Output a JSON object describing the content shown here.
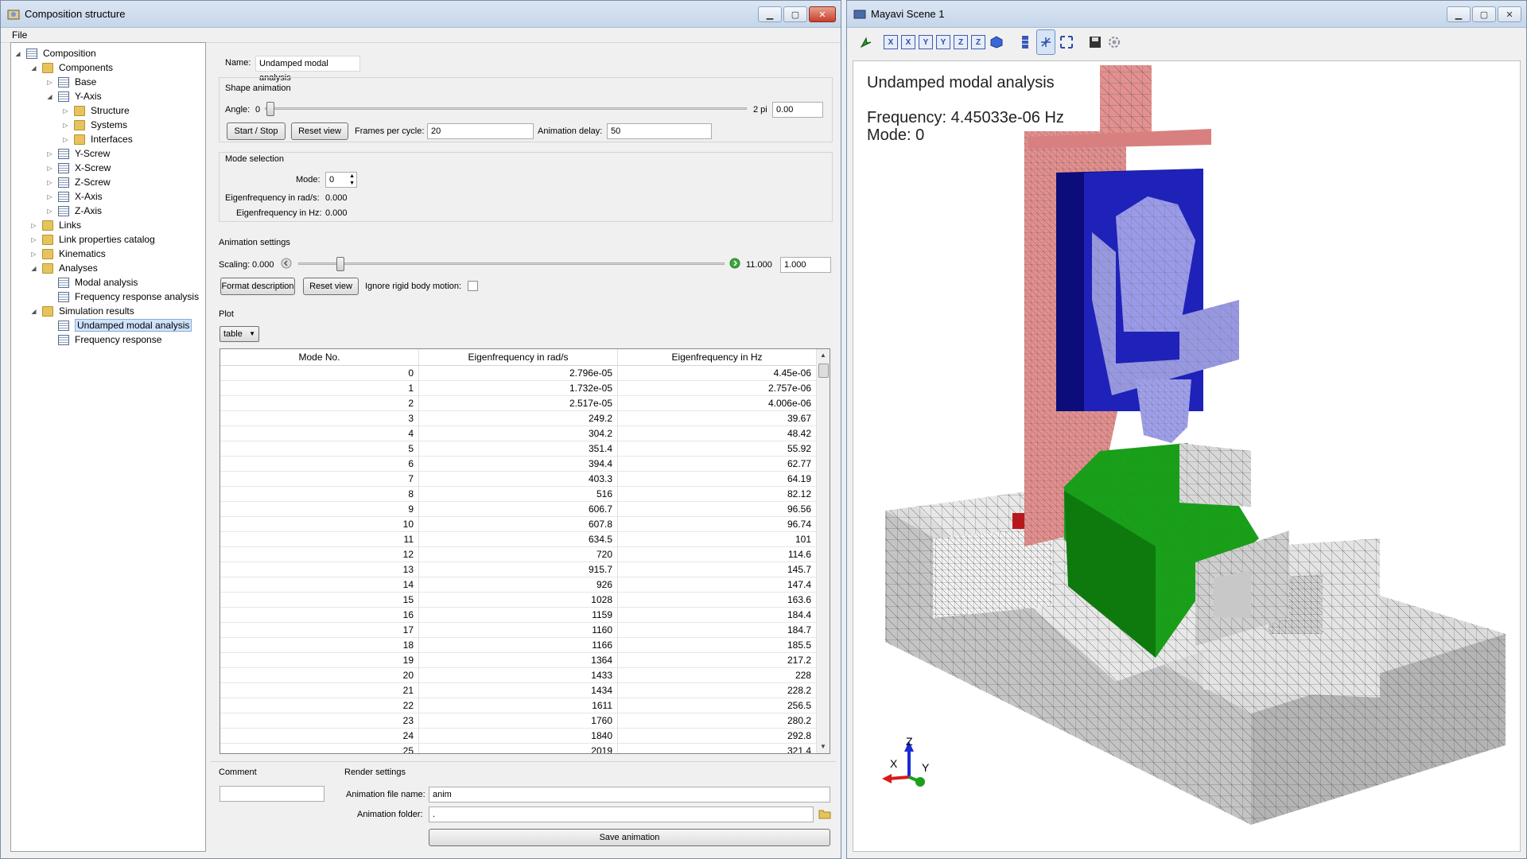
{
  "left_window": {
    "title": "Composition structure",
    "menu": {
      "file": "File"
    },
    "tree": [
      {
        "label": "Composition",
        "icon": "doc-icon",
        "depth": 0,
        "expander": "open"
      },
      {
        "label": "Components",
        "icon": "folder-icon",
        "depth": 1,
        "expander": "open"
      },
      {
        "label": "Base",
        "icon": "doc-icon",
        "depth": 2,
        "expander": "closed"
      },
      {
        "label": "Y-Axis",
        "icon": "doc-icon",
        "depth": 2,
        "expander": "open"
      },
      {
        "label": "Structure",
        "icon": "folder-icon",
        "depth": 3,
        "expander": "closed"
      },
      {
        "label": "Systems",
        "icon": "folder-icon",
        "depth": 3,
        "expander": "closed"
      },
      {
        "label": "Interfaces",
        "icon": "folder-icon",
        "depth": 3,
        "expander": "closed"
      },
      {
        "label": "Y-Screw",
        "icon": "doc-icon",
        "depth": 2,
        "expander": "closed"
      },
      {
        "label": "X-Screw",
        "icon": "doc-icon",
        "depth": 2,
        "expander": "closed"
      },
      {
        "label": "Z-Screw",
        "icon": "doc-icon",
        "depth": 2,
        "expander": "closed"
      },
      {
        "label": "X-Axis",
        "icon": "doc-icon",
        "depth": 2,
        "expander": "closed"
      },
      {
        "label": "Z-Axis",
        "icon": "doc-icon",
        "depth": 2,
        "expander": "closed"
      },
      {
        "label": "Links",
        "icon": "folder-icon",
        "depth": 1,
        "expander": "closed"
      },
      {
        "label": "Link properties catalog",
        "icon": "folder-icon",
        "depth": 1,
        "expander": "closed"
      },
      {
        "label": "Kinematics",
        "icon": "folder-icon",
        "depth": 1,
        "expander": "closed"
      },
      {
        "label": "Analyses",
        "icon": "folder-icon",
        "depth": 1,
        "expander": "open"
      },
      {
        "label": "Modal analysis",
        "icon": "doc-icon",
        "depth": 2,
        "expander": "none"
      },
      {
        "label": "Frequency response analysis",
        "icon": "doc-icon",
        "depth": 2,
        "expander": "none"
      },
      {
        "label": "Simulation results",
        "icon": "folder-icon",
        "depth": 1,
        "expander": "open"
      },
      {
        "label": "Undamped modal analysis",
        "icon": "doc-icon",
        "depth": 2,
        "expander": "none",
        "selected": true
      },
      {
        "label": "Frequency response",
        "icon": "doc-icon",
        "depth": 2,
        "expander": "none"
      }
    ],
    "name_label": "Name:",
    "name_value": "Undamped modal analysis",
    "shape_animation": {
      "title": "Shape animation",
      "angle_label": "Angle:",
      "angle_min": "0",
      "angle_max": "2 pi",
      "angle_value": "0.00",
      "start_stop": "Start / Stop",
      "reset_view": "Reset view",
      "frames_label": "Frames per cycle:",
      "frames_value": "20",
      "delay_label": "Animation delay:",
      "delay_value": "50"
    },
    "mode_selection": {
      "title": "Mode selection",
      "mode_label": "Mode:",
      "mode_value": "0",
      "rad_label": "Eigenfrequency in rad/s:",
      "rad_value": "0.000",
      "hz_label": "Eigenfrequency in Hz:",
      "hz_value": "0.000"
    },
    "animation_settings": {
      "title": "Animation settings",
      "scaling_label": "Scaling:",
      "scaling_min": "0.000",
      "scaling_max": "11.000",
      "scaling_value": "1.000",
      "format_description": "Format description",
      "reset_view": "Reset view",
      "ignore_label": "Ignore rigid body motion:"
    },
    "plot": {
      "title": "Plot",
      "select_value": "table",
      "columns": [
        "Mode No.",
        "Eigenfrequency in rad/s",
        "Eigenfrequency in Hz"
      ],
      "rows": [
        [
          "0",
          "2.796e-05",
          "4.45e-06"
        ],
        [
          "1",
          "1.732e-05",
          "2.757e-06"
        ],
        [
          "2",
          "2.517e-05",
          "4.006e-06"
        ],
        [
          "3",
          "249.2",
          "39.67"
        ],
        [
          "4",
          "304.2",
          "48.42"
        ],
        [
          "5",
          "351.4",
          "55.92"
        ],
        [
          "6",
          "394.4",
          "62.77"
        ],
        [
          "7",
          "403.3",
          "64.19"
        ],
        [
          "8",
          "516",
          "82.12"
        ],
        [
          "9",
          "606.7",
          "96.56"
        ],
        [
          "10",
          "607.8",
          "96.74"
        ],
        [
          "11",
          "634.5",
          "101"
        ],
        [
          "12",
          "720",
          "114.6"
        ],
        [
          "13",
          "915.7",
          "145.7"
        ],
        [
          "14",
          "926",
          "147.4"
        ],
        [
          "15",
          "1028",
          "163.6"
        ],
        [
          "16",
          "1159",
          "184.4"
        ],
        [
          "17",
          "1160",
          "184.7"
        ],
        [
          "18",
          "1166",
          "185.5"
        ],
        [
          "19",
          "1364",
          "217.2"
        ],
        [
          "20",
          "1433",
          "228"
        ],
        [
          "21",
          "1434",
          "228.2"
        ],
        [
          "22",
          "1611",
          "256.5"
        ],
        [
          "23",
          "1760",
          "280.2"
        ],
        [
          "24",
          "1840",
          "292.8"
        ],
        [
          "25",
          "2019",
          "321.4"
        ]
      ]
    },
    "comment_label": "Comment",
    "render_settings": {
      "title": "Render settings",
      "file_label": "Animation file name:",
      "file_value": "anim",
      "folder_label": "Animation folder:",
      "folder_value": ".",
      "save": "Save animation"
    }
  },
  "right_window": {
    "title": "Mayavi Scene 1",
    "toolbar": [
      "arrow-icon",
      "view-x-icon",
      "view-x-neg-icon",
      "view-y-icon",
      "view-y-neg-icon",
      "view-z-icon",
      "view-z-neg-icon",
      "iso-view-icon",
      "parallel-projection-icon",
      "axes-toggle-icon",
      "fullscreen-icon",
      "save-icon",
      "settings-icon"
    ],
    "toolbar_text": {
      "x1": "X",
      "x2": "X",
      "y1": "Y",
      "y2": "Y",
      "z1": "Z",
      "z2": "Z"
    },
    "scene_title": "Undamped modal analysis",
    "frequency": "Frequency: 4.45033e-06 Hz",
    "mode": "Mode: 0",
    "axes": {
      "x": "X",
      "y": "Y",
      "z": "Z"
    }
  },
  "colors": {
    "pink_column": "#e3908f",
    "blue_slide": "#1a1ea8",
    "lavender_spindle": "#9a9ae8",
    "green_table": "#1aa01a",
    "gray_base": "#d8d8d8"
  }
}
